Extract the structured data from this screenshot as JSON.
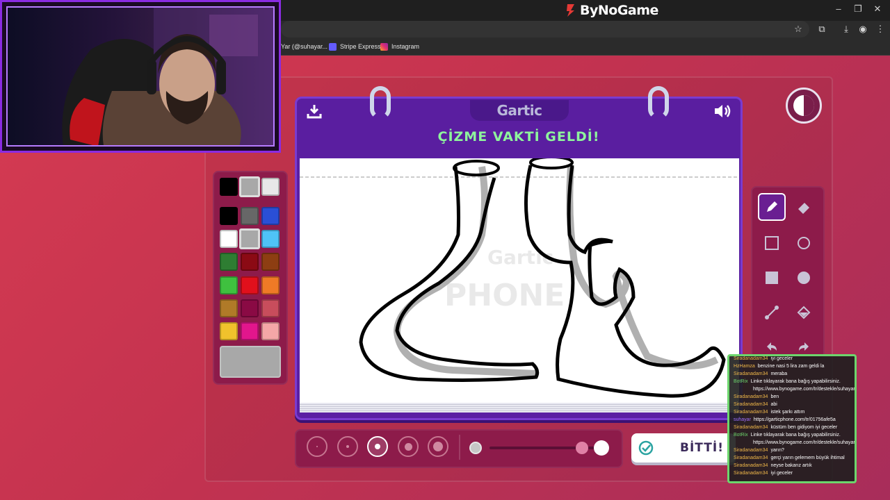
{
  "browser": {
    "brand": "ByNoGame",
    "bookmarks": [
      {
        "label": "Yar (@suhayar...",
        "color": "#888"
      },
      {
        "label": "Stripe Express",
        "color": "#635bff"
      },
      {
        "label": "Instagram",
        "color": "#e1306c"
      }
    ]
  },
  "game": {
    "logo": "Gartic",
    "title": "ÇİZME VAKTİ GELDİ!",
    "watermark": "Gartic PHONE",
    "done_label": "BİTTİ!",
    "palette_colors": [
      "#000000",
      "#a8a8a8",
      "#e8e8e8",
      "#000000",
      "#676767",
      "#2a4fd6",
      "#ffffff",
      "#a8a8a8",
      "#4fc3f7",
      "#2e7d32",
      "#8b0a14",
      "#8d3e12",
      "#3fc13f",
      "#e1101c",
      "#ef7a26",
      "#b07a28",
      "#8a0a44",
      "#c84d5c",
      "#f0c22c",
      "#e2168c",
      "#f4a7a7"
    ],
    "selected_color": "#a8a8a8",
    "brush_size_selected": 3,
    "opacity": 1.0,
    "tools": [
      "pencil-icon",
      "eraser-icon",
      "square-outline-icon",
      "circle-outline-icon",
      "square-filled-icon",
      "circle-filled-icon",
      "line-icon",
      "fill-bucket-icon",
      "undo-icon",
      "redo-icon"
    ]
  },
  "chat": {
    "messages": [
      {
        "user": "Siradanadam34",
        "text": "iyi geceler",
        "color": "#f0b84a"
      },
      {
        "user": "HzHamza",
        "text": "benzine nasi 5 lira zam geldi la",
        "color": "#f0b84a"
      },
      {
        "user": "Siradanadam34",
        "text": "meraba",
        "color": "#f0b84a"
      },
      {
        "user": "BotRix",
        "text": "Linke tıklayarak bana bağış yapabilirsiniz.",
        "color": "#6dd66d"
      },
      {
        "user": "",
        "text": "https://www.bynogame.com/tr/destekle/suhayar",
        "color": "#fff"
      },
      {
        "user": "Siradanadam34",
        "text": "ben",
        "color": "#f0b84a"
      },
      {
        "user": "Siradanadam34",
        "text": "abi",
        "color": "#f0b84a"
      },
      {
        "user": "Siradanadam34",
        "text": "istek şarkı attım",
        "color": "#f0b84a"
      },
      {
        "user": "suhayar",
        "text": "https://garticphone.com/tr/01756afe5a",
        "color": "#a070ff"
      },
      {
        "user": "Siradanadam34",
        "text": "küstüm ben gidiyom iyi geceler",
        "color": "#f0b84a"
      },
      {
        "user": "BotRix",
        "text": "Linke tıklayarak bana bağış yapabilirsiniz.",
        "color": "#6dd66d"
      },
      {
        "user": "",
        "text": "https://www.bynogame.com/tr/destekle/suhayar",
        "color": "#fff"
      },
      {
        "user": "Siradanadam34",
        "text": "yarın?",
        "color": "#f0b84a"
      },
      {
        "user": "Siradanadam34",
        "text": "gerçi yarın gelemem büyük ihtimal",
        "color": "#f0b84a"
      },
      {
        "user": "Siradanadam34",
        "text": "neyse bakarız artık",
        "color": "#f0b84a"
      },
      {
        "user": "Siradanadam34",
        "text": "iyi geceler",
        "color": "#f0b84a"
      }
    ]
  }
}
